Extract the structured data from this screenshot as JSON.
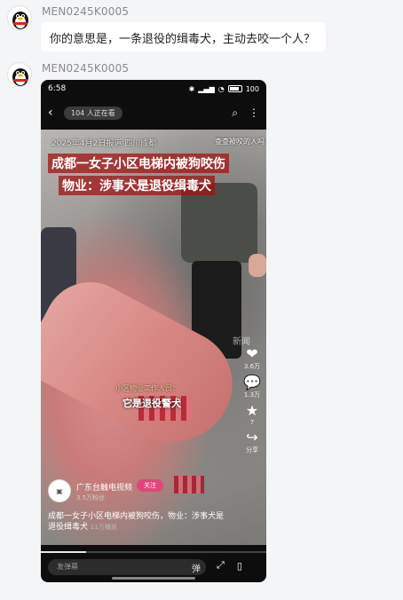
{
  "messages": [
    {
      "sender": "MEN0245K0005",
      "text": "你的意思是，一条退役的缉毒犬，主动去咬一个人？"
    },
    {
      "sender": "MEN0245K0005"
    }
  ],
  "phone": {
    "status": {
      "time": "6:58",
      "battery": "100"
    },
    "topbar": {
      "live_count": "104 人正在看",
      "search_icon": "search-icon",
      "more_icon": "more-vertical-icon"
    },
    "video": {
      "date_line": "2025年4月2日报道 四川成都",
      "side_label": "查查被咬的人吗",
      "headline1": "成都一女子小区电梯内被狗咬伤",
      "headline2": "物业：涉事犬是退役缉毒犬",
      "watermark": "新闻",
      "caption_speaker": "小区物业工作人员：",
      "caption_text": "它是退役警犬"
    },
    "rail": [
      {
        "icon": "❤",
        "name": "like-icon",
        "count": "3.6万"
      },
      {
        "icon": "💬",
        "name": "comment-icon",
        "count": "1.3万"
      },
      {
        "icon": "★",
        "name": "favorite-icon",
        "count": "7"
      },
      {
        "icon": "↪",
        "name": "share-icon",
        "count": "分享"
      }
    ],
    "author": {
      "name": "广东台触电视频",
      "follow": "关注",
      "fans": "3.5万粉丝"
    },
    "description": "成都一女子小区电梯内被狗咬伤，物业：涉事犬是退役缉毒犬",
    "views": "11万播放",
    "progress": 0.2,
    "comment_placeholder": "发弹幕",
    "emoji": "弹"
  }
}
